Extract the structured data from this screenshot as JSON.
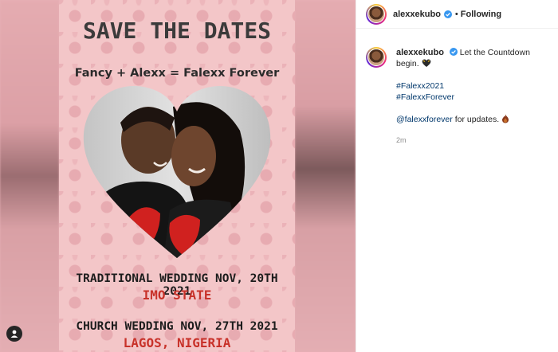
{
  "poster": {
    "title": "SAVE THE DATES",
    "subtitle": "Fancy + Alexx = Falexx Forever",
    "traditional": "TRADITIONAL WEDDING NOV, 20TH 2021",
    "traditional_location": "IMO STATE",
    "church": "CHURCH WEDDING NOV, 27TH 2021",
    "church_location": "LAGOS, NIGERIA"
  },
  "header": {
    "username": "alexxekubo",
    "follow_status": "Following"
  },
  "post": {
    "username": "alexxekubo",
    "caption": "Let the Countdown begin.",
    "hashtags": [
      "#Falexx2021",
      "#FalexxForever"
    ],
    "mention": "@falexxforever",
    "mention_suffix": "for updates.",
    "time": "2m"
  },
  "colors": {
    "poster_pink": "#f3c6c8",
    "location_red": "#c8322a",
    "link_blue": "#00376b",
    "verified_blue": "#3897f0"
  },
  "icons": {
    "verified": "verified-badge-icon",
    "user_tag": "user-icon",
    "emoji_1": "dark-heart-emoji-icon",
    "emoji_2": "fire-emoji-icon"
  }
}
